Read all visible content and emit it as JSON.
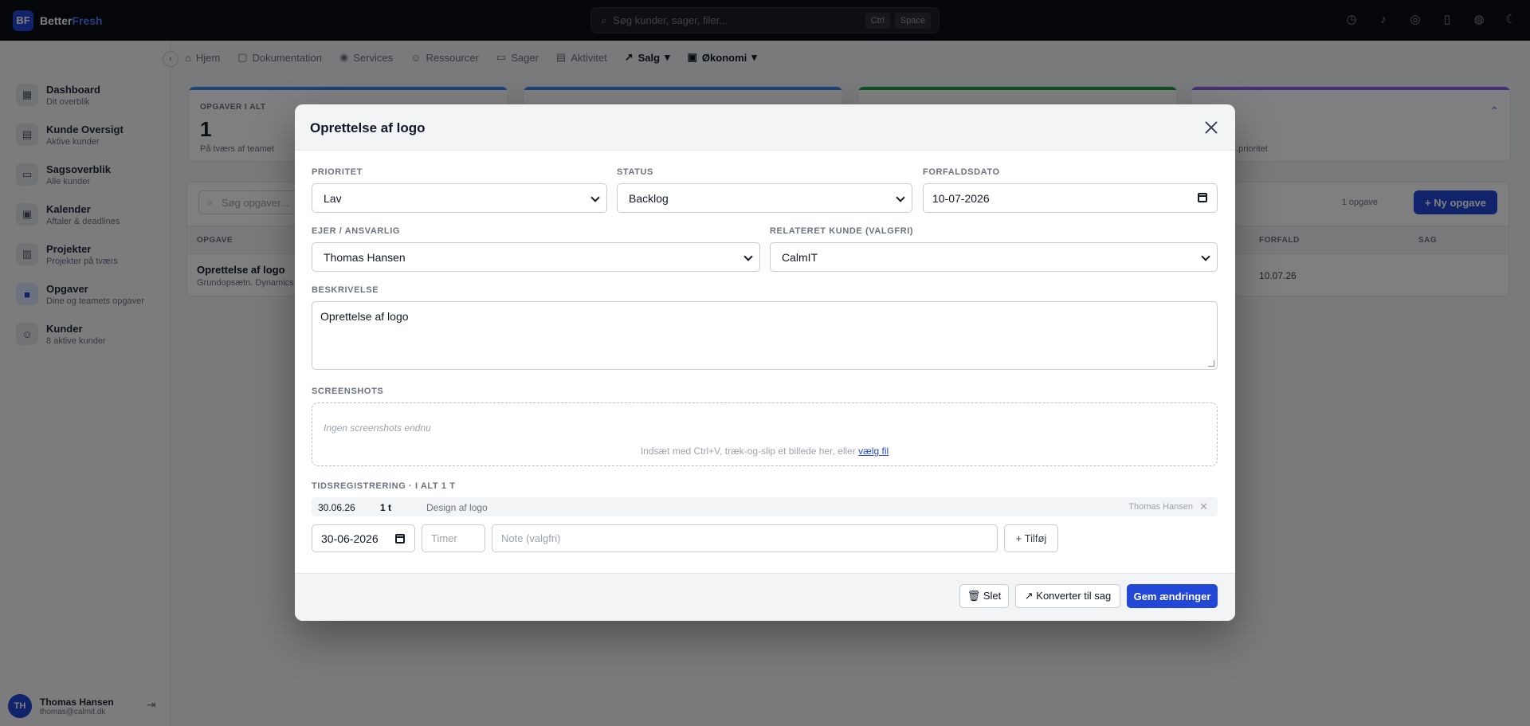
{
  "brand": {
    "logo": "BF",
    "name_a": "Better",
    "name_b": "Fresh"
  },
  "search": {
    "placeholder": "Søg kunder, sager, filer...",
    "kbd1": "Ctrl",
    "kbd2": "Space"
  },
  "subnav": [
    "Hjem",
    "Dokumentation",
    "Services",
    "Ressourcer",
    "Sager",
    "Aktivitet",
    "Salg",
    "Økonomi"
  ],
  "sidebar": {
    "items": [
      {
        "title": "Dashboard",
        "sub": "Dit overblik"
      },
      {
        "title": "Kunde Oversigt",
        "sub": "Aktive kunder"
      },
      {
        "title": "Sagsoverblik",
        "sub": "Alle kunder"
      },
      {
        "title": "Kalender",
        "sub": "Aftaler & deadlines"
      },
      {
        "title": "Projekter",
        "sub": "Projekter på tværs"
      },
      {
        "title": "Opgaver",
        "sub": "Dine og teamets opgaver"
      },
      {
        "title": "Kunder",
        "sub": "8 aktive kunder"
      }
    ],
    "user": {
      "initials": "TH",
      "name": "Thomas Hansen",
      "email": "thomas@calmit.dk"
    }
  },
  "stats": [
    {
      "label": "OPGAVER I ALT",
      "value": "1",
      "note": "På tværs af teamet",
      "color": "#3b82f6"
    },
    {
      "label": "",
      "value": "",
      "note": "",
      "color": "#3b82f6"
    },
    {
      "label": "",
      "value": "",
      "note": "",
      "color": "#16a34a"
    },
    {
      "label": "",
      "value": "",
      "note": "...prioritet",
      "color": "#8b5cf6"
    }
  ],
  "tasks": {
    "search_placeholder": "Søg opgaver...",
    "count": "1 opgave",
    "new_button": "+ Ny opgave",
    "headers": {
      "task": "OPGAVE",
      "due": "FORFALD",
      "case": "SAG"
    },
    "row": {
      "title": "Oprettelse af logo",
      "sub": "Grundopsætn. Dynamics...",
      "due": "10.07.26"
    }
  },
  "modal": {
    "title": "Oprettelse af logo",
    "priority": {
      "label": "PRIORITET",
      "value": "Lav"
    },
    "status": {
      "label": "STATUS",
      "value": "Backlog"
    },
    "due_date": {
      "label": "FORFALDSDATO",
      "value": "10-07-2026"
    },
    "owner": {
      "label": "EJER / ANSVARLIG",
      "value": "Thomas Hansen"
    },
    "customer": {
      "label": "RELATERET KUNDE (VALGFRI)",
      "value": "CalmIT"
    },
    "description": {
      "label": "BESKRIVELSE",
      "value": "Oprettelse af logo"
    },
    "screenshots": {
      "label": "SCREENSHOTS",
      "empty": "Ingen screenshots endnu",
      "hint": "Indsæt med Ctrl+V, træk-og-slip et billede her, eller",
      "link": "vælg fil"
    },
    "time": {
      "label": "TIDSREGISTRERING · I ALT 1 T",
      "entries": [
        {
          "date": "30.06.26",
          "hours": "1 t",
          "note": "Design af logo",
          "user": "Thomas Hansen"
        }
      ],
      "new_date": "30-06-2026",
      "hours_placeholder": "Timer",
      "note_placeholder": "Note (valgfri)",
      "add_button": "+ Tilføj"
    },
    "footer": {
      "delete": "🗑 Slet",
      "convert": "↗ Konverter til sag",
      "save": "Gem ændringer"
    }
  }
}
